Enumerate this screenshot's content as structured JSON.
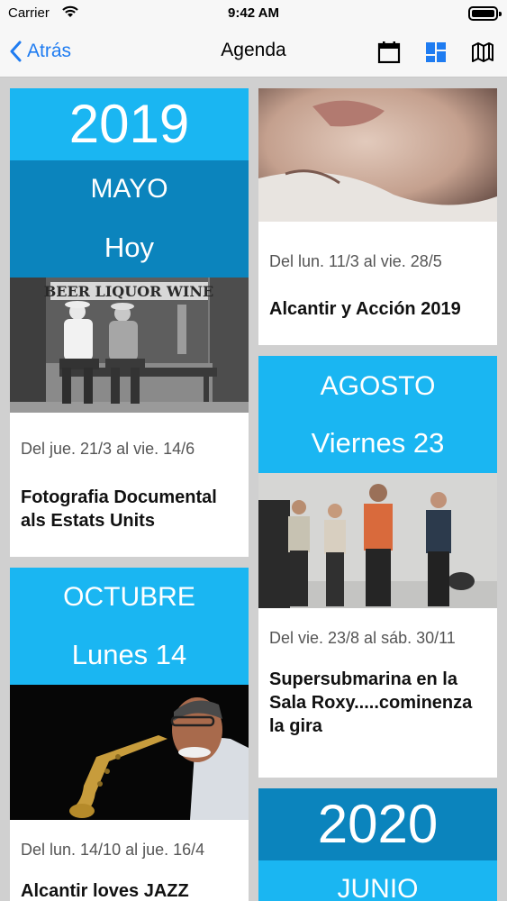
{
  "status_bar": {
    "carrier": "Carrier",
    "time": "9:42 AM"
  },
  "nav": {
    "back_label": "Atrás",
    "title": "Agenda",
    "icons": [
      "calendar-icon",
      "grid-view-icon",
      "map-icon"
    ],
    "tint": "#1f7cf1"
  },
  "colors": {
    "year_banner": "#1ab6f2",
    "month_banner": "#0b84bd",
    "background": "#d0d0d0"
  },
  "left_column": {
    "card1": {
      "year": "2019",
      "month": "MAYO",
      "day": "Hoy",
      "image": "old men sitting on bench photo",
      "sign_text": "BEER LIQUOR WINE",
      "dates": "Del jue. 21/3 al vie. 14/6",
      "title": "Fotografia Documental als Estats Units"
    },
    "card2": {
      "month": "OCTUBRE",
      "day": "Lunes 14",
      "image": "saxophone player photo",
      "dates": "Del lun. 14/10 al jue. 16/4",
      "title": "Alcantir loves JAZZ"
    }
  },
  "right_column": {
    "card1": {
      "image": "face close-up photo",
      "dates": "Del lun. 11/3 al vie. 28/5",
      "title": "Alcantir y Acción 2019"
    },
    "card2": {
      "month": "AGOSTO",
      "day": "Viernes 23",
      "image": "band group photo",
      "dates": "Del vie. 23/8 al sáb. 30/11",
      "title": "Supersubmarina en la Sala Roxy.....cominenza la gira"
    },
    "card3": {
      "year": "2020",
      "month": "JUNIO"
    }
  }
}
